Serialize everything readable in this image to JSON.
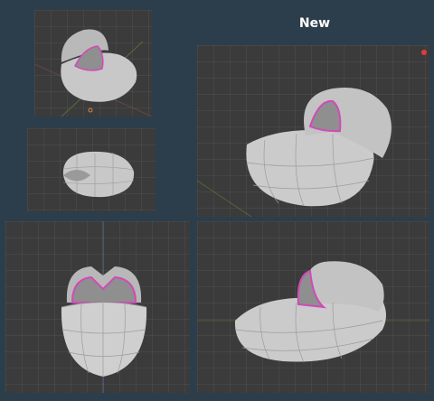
{
  "header": {
    "title": "New"
  },
  "panels": [
    {
      "name": "top-left-perspective-view"
    },
    {
      "name": "middle-left-top-view"
    },
    {
      "name": "bottom-left-front-view"
    },
    {
      "name": "top-right-perspective-view"
    },
    {
      "name": "bottom-right-side-view"
    }
  ],
  "colors": {
    "background": "#2c3e4b",
    "viewport": "#3b3b3b",
    "mesh": "#c8c8c8",
    "edge_highlight": "#d14ab8"
  }
}
